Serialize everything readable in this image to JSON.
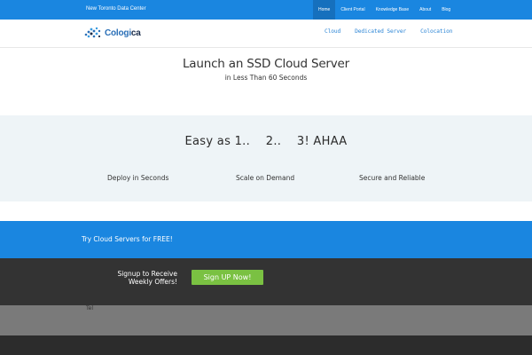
{
  "topbar": {
    "tagline": "New Toronto Data Center",
    "nav": [
      "Home",
      "Client Portal",
      "Knowledge Base",
      "About",
      "Blog"
    ],
    "active": "Home",
    "color": "#1a86e0"
  },
  "header": {
    "logo_main": "Cologi",
    "logo_accent": "ca",
    "nav": [
      "Cloud",
      "Dedicated Server",
      "Colocation"
    ]
  },
  "hero": {
    "title": "Launch an SSD Cloud Server",
    "subtitle": "in Less Than 60 Seconds"
  },
  "features": {
    "heading": "Easy as 1..    2..    3! AHAA",
    "items": [
      "Deploy in Seconds",
      "Scale on Demand",
      "Secure and Reliable"
    ]
  },
  "try_band": {
    "text": "Try Cloud Servers for FREE!"
  },
  "signup": {
    "label_line1": "Signup to Receive",
    "label_line2": "Weekly Offers!",
    "button": "Sign UP Now!",
    "button_color": "#7ac142"
  },
  "footer": {
    "text": "Tel"
  }
}
